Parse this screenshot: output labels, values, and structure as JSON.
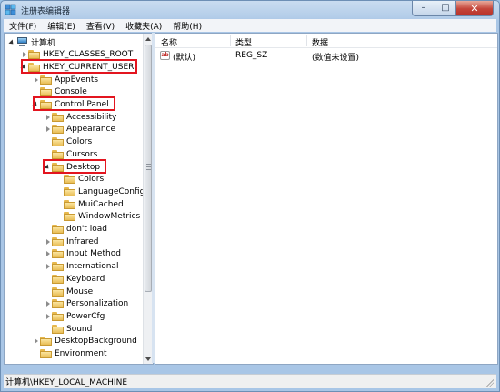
{
  "window": {
    "title": "注册表编辑器"
  },
  "menu": [
    "文件(F)",
    "编辑(E)",
    "查看(V)",
    "收藏夹(A)",
    "帮助(H)"
  ],
  "tree": [
    {
      "label": "计算机",
      "depth": 0,
      "state": "open",
      "icon": "computer-icon",
      "name": "tree-item-computer"
    },
    {
      "label": "HKEY_CLASSES_ROOT",
      "depth": 1,
      "state": "closed",
      "icon": "folder-icon",
      "name": "tree-item-hkey-classes-root"
    },
    {
      "label": "HKEY_CURRENT_USER",
      "depth": 1,
      "state": "open",
      "icon": "folder-icon",
      "name": "tree-item-hkey-current-user",
      "highlight": true
    },
    {
      "label": "AppEvents",
      "depth": 2,
      "state": "closed",
      "icon": "folder-icon",
      "name": "tree-item-appevents"
    },
    {
      "label": "Console",
      "depth": 2,
      "state": "none",
      "icon": "folder-icon",
      "name": "tree-item-console"
    },
    {
      "label": "Control Panel",
      "depth": 2,
      "state": "open",
      "icon": "folder-icon",
      "name": "tree-item-control-panel",
      "highlight": true
    },
    {
      "label": "Accessibility",
      "depth": 3,
      "state": "closed",
      "icon": "folder-icon",
      "name": "tree-item-accessibility"
    },
    {
      "label": "Appearance",
      "depth": 3,
      "state": "closed",
      "icon": "folder-icon",
      "name": "tree-item-appearance"
    },
    {
      "label": "Colors",
      "depth": 3,
      "state": "none",
      "icon": "folder-icon",
      "name": "tree-item-colors"
    },
    {
      "label": "Cursors",
      "depth": 3,
      "state": "none",
      "icon": "folder-icon",
      "name": "tree-item-cursors"
    },
    {
      "label": "Desktop",
      "depth": 3,
      "state": "open",
      "icon": "folder-icon",
      "name": "tree-item-desktop",
      "highlight": true
    },
    {
      "label": "Colors",
      "depth": 4,
      "state": "none",
      "icon": "folder-icon",
      "name": "tree-item-desktop-colors"
    },
    {
      "label": "LanguageConfig",
      "depth": 4,
      "state": "none",
      "icon": "folder-icon",
      "name": "tree-item-languageconfig"
    },
    {
      "label": "MuiCached",
      "depth": 4,
      "state": "none",
      "icon": "folder-icon",
      "name": "tree-item-muicached"
    },
    {
      "label": "WindowMetrics",
      "depth": 4,
      "state": "none",
      "icon": "folder-icon",
      "name": "tree-item-windowmetrics"
    },
    {
      "label": "don't load",
      "depth": 3,
      "state": "none",
      "icon": "folder-icon",
      "name": "tree-item-dont-load"
    },
    {
      "label": "Infrared",
      "depth": 3,
      "state": "closed",
      "icon": "folder-icon",
      "name": "tree-item-infrared"
    },
    {
      "label": "Input Method",
      "depth": 3,
      "state": "closed",
      "icon": "folder-icon",
      "name": "tree-item-input-method"
    },
    {
      "label": "International",
      "depth": 3,
      "state": "closed",
      "icon": "folder-icon",
      "name": "tree-item-international"
    },
    {
      "label": "Keyboard",
      "depth": 3,
      "state": "none",
      "icon": "folder-icon",
      "name": "tree-item-keyboard"
    },
    {
      "label": "Mouse",
      "depth": 3,
      "state": "none",
      "icon": "folder-icon",
      "name": "tree-item-mouse"
    },
    {
      "label": "Personalization",
      "depth": 3,
      "state": "closed",
      "icon": "folder-icon",
      "name": "tree-item-personalization"
    },
    {
      "label": "PowerCfg",
      "depth": 3,
      "state": "closed",
      "icon": "folder-icon",
      "name": "tree-item-powercfg"
    },
    {
      "label": "Sound",
      "depth": 3,
      "state": "none",
      "icon": "folder-icon",
      "name": "tree-item-sound"
    },
    {
      "label": "DesktopBackground",
      "depth": 2,
      "state": "closed",
      "icon": "folder-icon",
      "name": "tree-item-desktopbackground"
    },
    {
      "label": "Environment",
      "depth": 2,
      "state": "none",
      "icon": "folder-icon",
      "name": "tree-item-environment"
    }
  ],
  "list": {
    "columns": [
      "名称",
      "类型",
      "数据"
    ],
    "rows": [
      {
        "name": "(默认)",
        "type": "REG_SZ",
        "data": "(数值未设置)",
        "icon": "string-value-icon"
      }
    ]
  },
  "status": "计算机\\HKEY_LOCAL_MACHINE",
  "colors": {
    "highlight": "#e3151f",
    "chrome": "#a9c6e6"
  }
}
